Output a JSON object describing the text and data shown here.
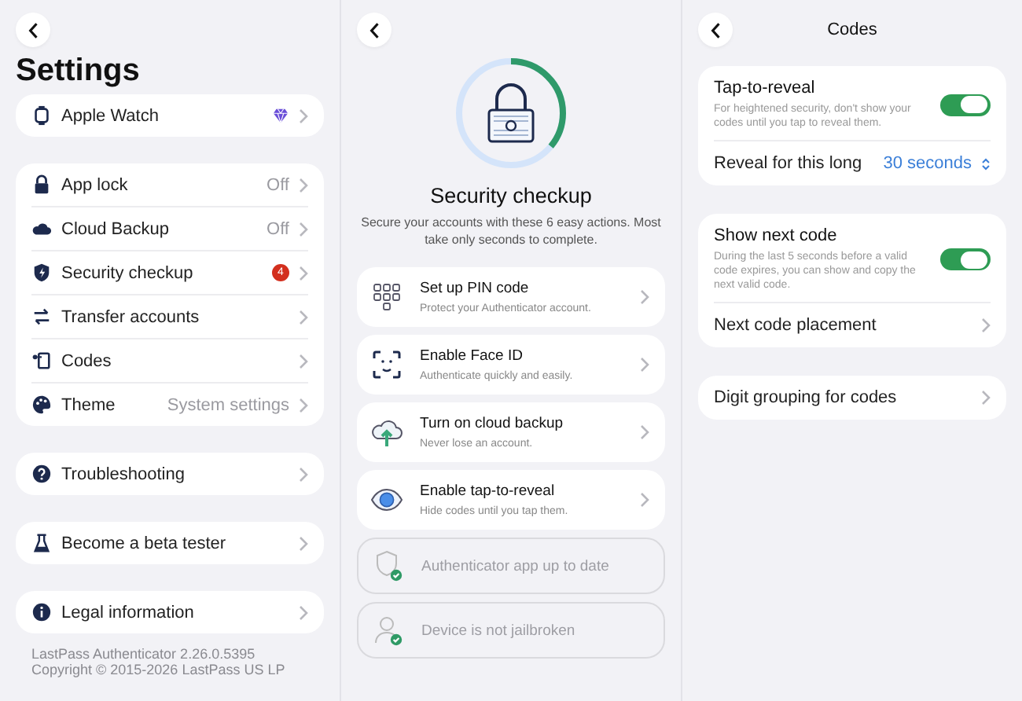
{
  "settings": {
    "title": "Settings",
    "groups": [
      [
        {
          "label": "Apple Watch",
          "premium": true
        }
      ],
      [
        {
          "label": "App lock",
          "value": "Off"
        },
        {
          "label": "Cloud Backup",
          "value": "Off"
        },
        {
          "label": "Security checkup",
          "badge": "4"
        },
        {
          "label": "Transfer accounts"
        },
        {
          "label": "Codes"
        },
        {
          "label": "Theme",
          "value": "System settings"
        }
      ],
      [
        {
          "label": "Troubleshooting"
        }
      ],
      [
        {
          "label": "Become a beta tester"
        }
      ],
      [
        {
          "label": "Legal information"
        }
      ]
    ],
    "footer": [
      "LastPass Authenticator 2.26.0.5395",
      "Copyright © 2015-2026 LastPass US LP"
    ]
  },
  "checkup": {
    "title": "Security checkup",
    "level": 0.36,
    "description": "Secure your accounts with these 6 easy actions. Most take only seconds to complete.",
    "items": [
      {
        "kind": "action",
        "title": "Set up PIN code",
        "subtitle": "Protect your Authenticator account."
      },
      {
        "kind": "action",
        "title": "Enable Face ID",
        "subtitle": "Authenticate quickly and easily."
      },
      {
        "kind": "action",
        "title": "Turn on cloud backup",
        "subtitle": "Never lose an account."
      },
      {
        "kind": "action",
        "title": "Enable tap-to-reveal",
        "subtitle": "Hide codes until you tap them."
      },
      {
        "kind": "done",
        "title": "Authenticator app up to date"
      },
      {
        "kind": "done",
        "title": "Device is not jailbroken"
      }
    ]
  },
  "codes": {
    "title": "Codes",
    "groups": [
      [
        {
          "kind": "toggle",
          "label": "Tap-to-reveal",
          "description": "For heightened security, don't show your codes until you tap to reveal them.",
          "on": true
        },
        {
          "kind": "picker",
          "label": "Reveal for this long",
          "value": "30 seconds"
        }
      ],
      [
        {
          "kind": "toggle",
          "label": "Show next code",
          "description": "During the last 5 seconds before a valid code expires, you can show and copy the next valid code.",
          "on": true
        },
        {
          "kind": "link",
          "label": "Next code placement"
        }
      ],
      [
        {
          "kind": "link",
          "label": "Digit grouping for codes"
        }
      ]
    ]
  }
}
